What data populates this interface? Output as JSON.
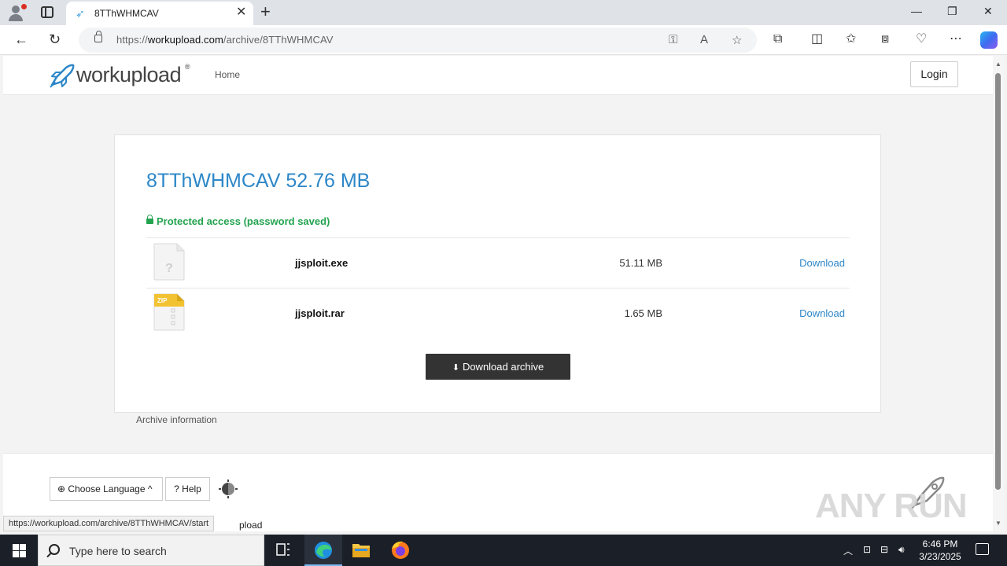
{
  "browser": {
    "tab_title": "8TThWHMCAV",
    "url_prefix": "https://",
    "url_domain": "workupload.com",
    "url_path": "/archive/8TThWHMCAV",
    "status_url": "https://workupload.com/archive/8TThWHMCAV/start"
  },
  "site": {
    "logo_text": "workupload",
    "logo_reg": "®",
    "nav_home": "Home",
    "login_label": "Login"
  },
  "archive": {
    "title": "8TThWHMCAV 52.76 MB",
    "protected_text": "Protected access (password saved)",
    "files": [
      {
        "name": "jjsploit.exe",
        "size": "51.11 MB",
        "action": "Download",
        "type_label": "?"
      },
      {
        "name": "jjsploit.rar",
        "size": "1.65 MB",
        "action": "Download",
        "type_label": "ZIP"
      }
    ],
    "download_archive_label": "Download archive",
    "archive_info_label": "Archive information"
  },
  "footer": {
    "language_label": "Choose Language",
    "help_label": "Help",
    "partial_text": "pload"
  },
  "watermark": {
    "text": "ANY RUN"
  },
  "taskbar": {
    "search_placeholder": "Type here to search",
    "time": "6:46 PM",
    "date": "3/23/2025"
  },
  "colors": {
    "accent_blue": "#2d87c8",
    "protected_green": "#23a34f",
    "button_dark": "#333333"
  }
}
